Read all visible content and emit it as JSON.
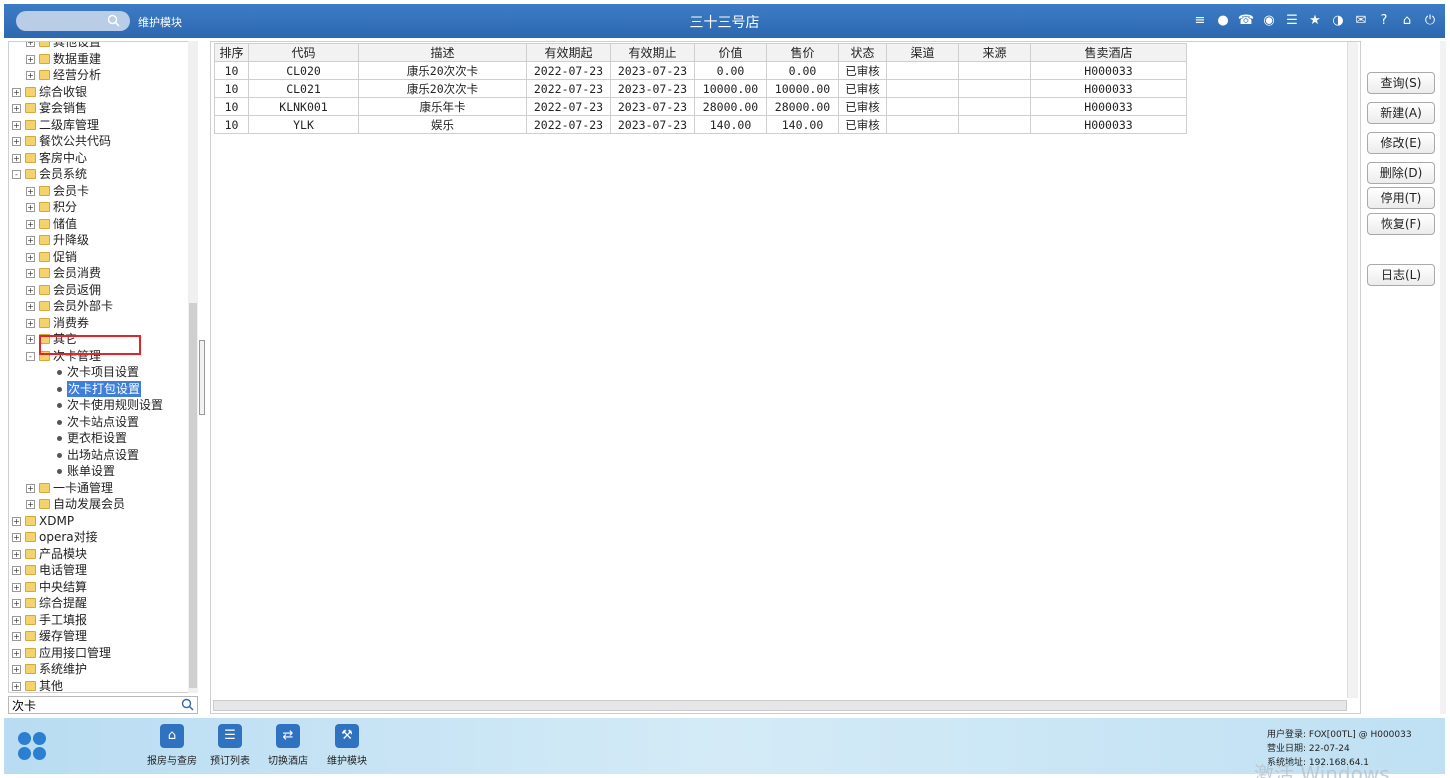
{
  "topbar": {
    "module_label": "维护模块",
    "store_title": "三十三号店",
    "icons": [
      "wifi-icon",
      "chat-icon",
      "phone-icon",
      "palette-icon",
      "menu-icon",
      "star-icon",
      "theme-icon",
      "mail-icon",
      "help-icon",
      "home-icon",
      "power-icon"
    ]
  },
  "tree": {
    "items": [
      {
        "label": "其他设置",
        "level": 1,
        "type": "folder",
        "expand": "+"
      },
      {
        "label": "数据重建",
        "level": 1,
        "type": "folder",
        "expand": "+"
      },
      {
        "label": "经营分析",
        "level": 1,
        "type": "folder",
        "expand": "+"
      },
      {
        "label": "综合收银",
        "level": 0,
        "type": "folder",
        "expand": "+"
      },
      {
        "label": "宴会销售",
        "level": 0,
        "type": "folder",
        "expand": "+"
      },
      {
        "label": "二级库管理",
        "level": 0,
        "type": "folder",
        "expand": "+"
      },
      {
        "label": "餐饮公共代码",
        "level": 0,
        "type": "folder",
        "expand": "+"
      },
      {
        "label": "客房中心",
        "level": 0,
        "type": "folder",
        "expand": "+"
      },
      {
        "label": "会员系统",
        "level": 0,
        "type": "folder",
        "expand": "-"
      },
      {
        "label": "会员卡",
        "level": 1,
        "type": "folder",
        "expand": "+"
      },
      {
        "label": "积分",
        "level": 1,
        "type": "folder",
        "expand": "+"
      },
      {
        "label": "储值",
        "level": 1,
        "type": "folder",
        "expand": "+"
      },
      {
        "label": "升降级",
        "level": 1,
        "type": "folder",
        "expand": "+"
      },
      {
        "label": "促销",
        "level": 1,
        "type": "folder",
        "expand": "+"
      },
      {
        "label": "会员消费",
        "level": 1,
        "type": "folder",
        "expand": "+"
      },
      {
        "label": "会员返佣",
        "level": 1,
        "type": "folder",
        "expand": "+"
      },
      {
        "label": "会员外部卡",
        "level": 1,
        "type": "folder",
        "expand": "+"
      },
      {
        "label": "消费券",
        "level": 1,
        "type": "folder",
        "expand": "+"
      },
      {
        "label": "其它",
        "level": 1,
        "type": "folder",
        "expand": "+"
      },
      {
        "label": "次卡管理",
        "level": 1,
        "type": "folder",
        "expand": "-"
      },
      {
        "label": "次卡项目设置",
        "level": 2,
        "type": "leaf"
      },
      {
        "label": "次卡打包设置",
        "level": 2,
        "type": "leaf",
        "selected": true
      },
      {
        "label": "次卡使用规则设置",
        "level": 2,
        "type": "leaf"
      },
      {
        "label": "次卡站点设置",
        "level": 2,
        "type": "leaf"
      },
      {
        "label": "更衣柜设置",
        "level": 2,
        "type": "leaf"
      },
      {
        "label": "出场站点设置",
        "level": 2,
        "type": "leaf"
      },
      {
        "label": "账单设置",
        "level": 2,
        "type": "leaf"
      },
      {
        "label": "一卡通管理",
        "level": 1,
        "type": "folder",
        "expand": "+"
      },
      {
        "label": "自动发展会员",
        "level": 1,
        "type": "folder",
        "expand": "+"
      },
      {
        "label": "XDMP",
        "level": 0,
        "type": "folder",
        "expand": "+"
      },
      {
        "label": "opera对接",
        "level": 0,
        "type": "folder",
        "expand": "+"
      },
      {
        "label": "产品模块",
        "level": 0,
        "type": "folder",
        "expand": "+"
      },
      {
        "label": "电话管理",
        "level": 0,
        "type": "folder",
        "expand": "+"
      },
      {
        "label": "中央结算",
        "level": 0,
        "type": "folder",
        "expand": "+"
      },
      {
        "label": "综合提醒",
        "level": 0,
        "type": "folder",
        "expand": "+"
      },
      {
        "label": "手工填报",
        "level": 0,
        "type": "folder",
        "expand": "+"
      },
      {
        "label": "缓存管理",
        "level": 0,
        "type": "folder",
        "expand": "+"
      },
      {
        "label": "应用接口管理",
        "level": 0,
        "type": "folder",
        "expand": "+"
      },
      {
        "label": "系统维护",
        "level": 0,
        "type": "folder",
        "expand": "+"
      },
      {
        "label": "其他",
        "level": 0,
        "type": "folder",
        "expand": "+"
      }
    ],
    "search_value": "次卡"
  },
  "grid": {
    "columns": [
      "排序",
      "代码",
      "描述",
      "有效期起",
      "有效期止",
      "价值",
      "售价",
      "状态",
      "渠道",
      "来源",
      "售卖酒店"
    ],
    "rows": [
      [
        "10",
        "CL020",
        "康乐20次次卡",
        "2022-07-23",
        "2023-07-23",
        "0.00",
        "0.00",
        "已审核",
        "",
        "",
        "H000033"
      ],
      [
        "10",
        "CL021",
        "康乐20次次卡",
        "2022-07-23",
        "2023-07-23",
        "10000.00",
        "10000.00",
        "已审核",
        "",
        "",
        "H000033"
      ],
      [
        "10",
        "KLNK001",
        "康乐年卡",
        "2022-07-23",
        "2023-07-23",
        "28000.00",
        "28000.00",
        "已审核",
        "",
        "",
        "H000033"
      ],
      [
        "10",
        "YLK",
        "娱乐",
        "2022-07-23",
        "2023-07-23",
        "140.00",
        "140.00",
        "已审核",
        "",
        "",
        "H000033"
      ]
    ]
  },
  "actions": {
    "query": "查询(S)",
    "new": "新建(A)",
    "edit": "修改(E)",
    "delete": "删除(D)",
    "disable": "停用(T)",
    "restore": "恢复(F)",
    "log": "日志(L)"
  },
  "footer": {
    "buttons": [
      "报房与查房",
      "预订列表",
      "切换酒店",
      "维护模块"
    ],
    "user_login": "用户登录: FOX[00TL] @ H000033",
    "business_date": "营业日期: 22-07-24",
    "system_address": "系统地址: 192.168.64.1",
    "watermark": "激活 Windows"
  }
}
